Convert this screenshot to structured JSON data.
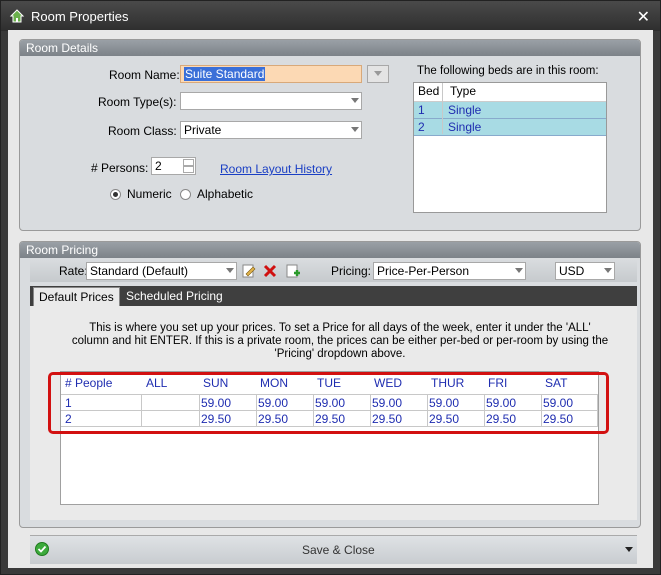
{
  "window": {
    "title": "Room Properties",
    "close_glyph": "✕"
  },
  "room_details": {
    "header": "Room Details",
    "room_name_label": "Room Name:",
    "room_name_value": "Suite Standard",
    "room_type_label": "Room Type(s):",
    "room_type_value": "",
    "room_class_label": "Room Class:",
    "room_class_value": "Private",
    "persons_label": "# Persons:",
    "persons_value": "2",
    "layout_history_link": "Room Layout History",
    "radio_numeric": "Numeric",
    "radio_alphabetic": "Alphabetic",
    "radio_selected": "Numeric",
    "beds_caption": "The following beds are in this room:",
    "beds_columns": [
      "Bed",
      "Type"
    ],
    "beds": [
      {
        "bed": "1",
        "type": "Single"
      },
      {
        "bed": "2",
        "type": "Single"
      }
    ]
  },
  "room_pricing": {
    "header": "Room Pricing",
    "rate_label": "Rate:",
    "rate_value": "Standard (Default)",
    "pricing_label": "Pricing:",
    "pricing_value": "Price-Per-Person",
    "currency_value": "USD",
    "tabs": [
      "Default Prices",
      "Scheduled Pricing"
    ],
    "active_tab": "Default Prices",
    "info_text": "This is where you set up your prices.  To set a Price for all days of the week, enter it under the 'ALL' column and hit ENTER.  If this is a private room, the prices can be either per-bed or per-room by using the 'Pricing' dropdown above.",
    "grid_columns": [
      "# People",
      "ALL",
      "SUN",
      "MON",
      "TUE",
      "WED",
      "THUR",
      "FRI",
      "SAT"
    ],
    "grid_rows": [
      [
        "1",
        "",
        "59.00",
        "59.00",
        "59.00",
        "59.00",
        "59.00",
        "59.00",
        "59.00"
      ],
      [
        "2",
        "",
        "29.50",
        "29.50",
        "29.50",
        "29.50",
        "29.50",
        "29.50",
        "29.50"
      ]
    ]
  },
  "footer": {
    "save_close_label": "Save & Close"
  },
  "colors": {
    "accent_link": "#1a3fc4",
    "highlight_border": "#d21010",
    "selected_row": "#a8dbe4"
  }
}
